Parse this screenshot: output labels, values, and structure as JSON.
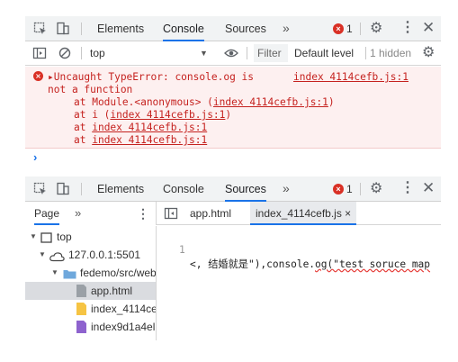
{
  "console_panel": {
    "tabs": [
      {
        "label": "Elements"
      },
      {
        "label": "Console"
      },
      {
        "label": "Sources"
      }
    ],
    "more": "»",
    "error_count": "1",
    "close": "✕",
    "context": "top",
    "filter_placeholder": "Filter",
    "level": "Default level",
    "hidden": "1 hidden",
    "error": {
      "line1": "▸Uncaught TypeError: console.og is",
      "line2": "not a function",
      "source_link": "index 4114cefb.js:1",
      "stack": [
        {
          "prefix": "at Module.<anonymous> (",
          "link": "index 4114cefb.js:1",
          "suffix": ")"
        },
        {
          "prefix": "at i (",
          "link": "index 4114cefb.js:1",
          "suffix": ")"
        },
        {
          "prefix": "at ",
          "link": "index 4114cefb.js:1",
          "suffix": ""
        },
        {
          "prefix": "at ",
          "link": "index 4114cefb.js:1",
          "suffix": ""
        }
      ]
    },
    "prompt": "›"
  },
  "sources_panel": {
    "tabs": [
      {
        "label": "Elements"
      },
      {
        "label": "Console"
      },
      {
        "label": "Sources"
      }
    ],
    "more": "»",
    "error_count": "1",
    "close": "✕",
    "navigator_tab": "Page",
    "navigator_more": "»",
    "editor_tabs": [
      {
        "label": "app.html"
      },
      {
        "label": "index_4114cefb.js ×"
      }
    ],
    "tree": [
      {
        "label": "top"
      },
      {
        "label": "127.0.0.1:5501"
      },
      {
        "label": "fedemo/src/web"
      },
      {
        "label": "app.html"
      },
      {
        "label": "index_4114ce"
      },
      {
        "label": "index9d1a4el"
      }
    ],
    "code": {
      "line_number": "1",
      "prefix": "<, 结婚就是\"),console.",
      "error_token": "og(\"test soruce map",
      "suffix": ""
    }
  },
  "colors": {
    "accent": "#1a73e8",
    "error": "#d93025",
    "error_bg": "#fdf0f0",
    "toolbar": "#f1f3f4"
  }
}
